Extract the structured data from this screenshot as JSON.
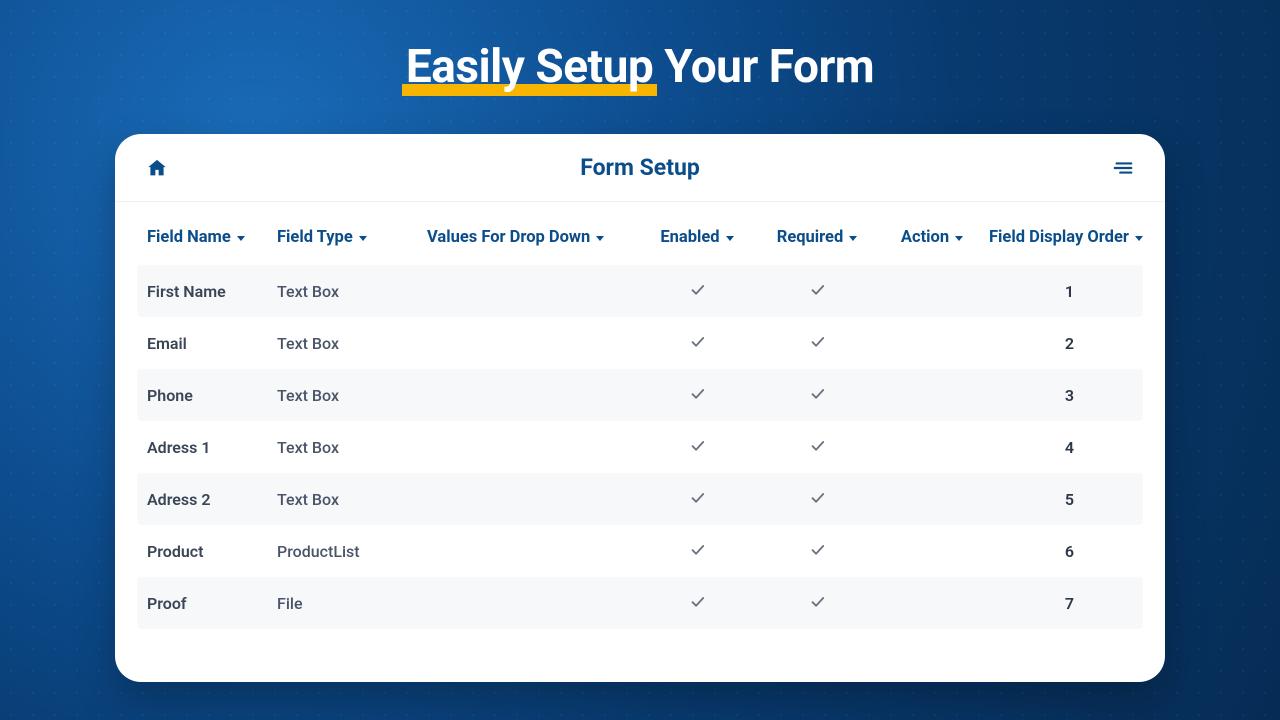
{
  "headline": {
    "highlight": "Easily Setup",
    "rest": " Your Form"
  },
  "card": {
    "title": "Form Setup"
  },
  "columns": {
    "field_name": "Field Name",
    "field_type": "Field Type",
    "values": "Values For Drop Down",
    "enabled": "Enabled",
    "required": "Required",
    "action": "Action",
    "order": "Field Display Order"
  },
  "rows": [
    {
      "name": "First Name",
      "type": "Text Box",
      "values": "",
      "enabled": true,
      "required": true,
      "action": "",
      "order": "1"
    },
    {
      "name": "Email",
      "type": "Text Box",
      "values": "",
      "enabled": true,
      "required": true,
      "action": "",
      "order": "2"
    },
    {
      "name": "Phone",
      "type": "Text Box",
      "values": "",
      "enabled": true,
      "required": true,
      "action": "",
      "order": "3"
    },
    {
      "name": "Adress 1",
      "type": "Text Box",
      "values": "",
      "enabled": true,
      "required": true,
      "action": "",
      "order": "4"
    },
    {
      "name": "Adress 2",
      "type": "Text Box",
      "values": "",
      "enabled": true,
      "required": true,
      "action": "",
      "order": "5"
    },
    {
      "name": "Product",
      "type": "ProductList",
      "values": "",
      "enabled": true,
      "required": true,
      "action": "",
      "order": "6"
    },
    {
      "name": "Proof",
      "type": "File",
      "values": "",
      "enabled": true,
      "required": true,
      "action": "",
      "order": "7"
    }
  ]
}
